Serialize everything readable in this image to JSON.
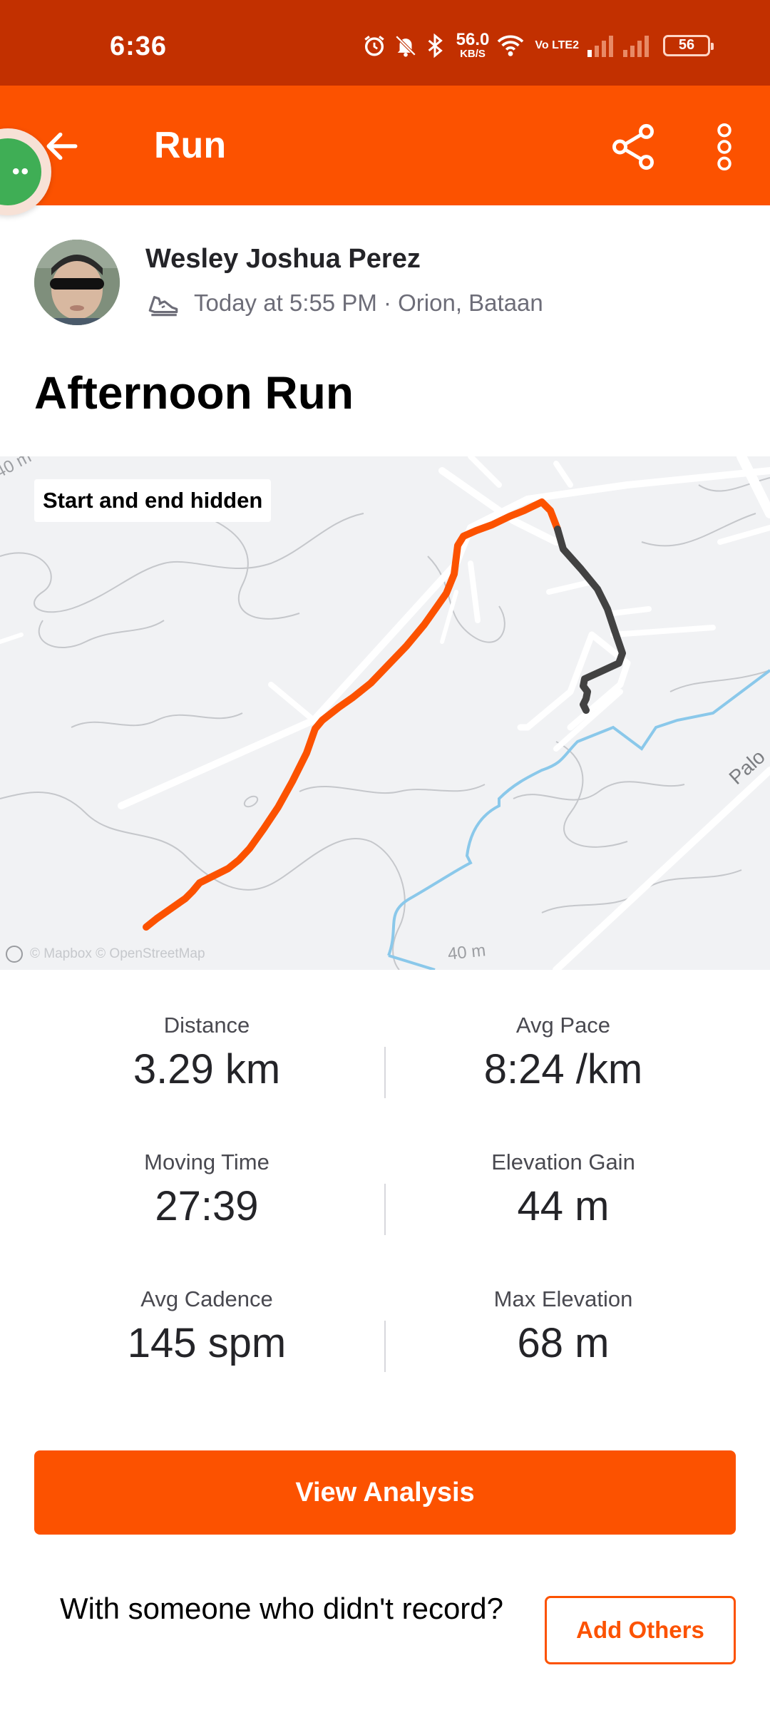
{
  "status_bar": {
    "time": "6:36",
    "net_speed_value": "56.0",
    "net_speed_unit": "KB/S",
    "volte": "Vo LTE2",
    "battery": "56"
  },
  "app_bar": {
    "title": "Run",
    "back_icon": "arrow-left-icon",
    "share_icon": "share-icon",
    "more_icon": "more-vertical-icon"
  },
  "chat_bubble": {
    "dots": "••"
  },
  "athlete": {
    "name": "Wesley Joshua Perez",
    "meta": "Today at 5:55 PM · Orion, Bataan",
    "sport_icon": "running-shoe-icon"
  },
  "activity": {
    "title": "Afternoon Run"
  },
  "map": {
    "badge": "Start and end hidden",
    "attribution": "© Mapbox © OpenStreetMap",
    "contour_top": "40 m",
    "contour_bottom": "40 m",
    "road_label": "Palo",
    "route_color": "#fc5200",
    "route_hidden_color": "#424242",
    "water_color": "#8ac8ea"
  },
  "stats": [
    {
      "left": {
        "label": "Distance",
        "value": "3.29 km"
      },
      "right": {
        "label": "Avg Pace",
        "value": "8:24 /km"
      }
    },
    {
      "left": {
        "label": "Moving Time",
        "value": "27:39"
      },
      "right": {
        "label": "Elevation Gain",
        "value": "44 m"
      }
    },
    {
      "left": {
        "label": "Avg Cadence",
        "value": "145 spm"
      },
      "right": {
        "label": "Max Elevation",
        "value": "68 m"
      }
    }
  ],
  "actions": {
    "view_analysis": "View Analysis",
    "someone_prompt": "With someone who didn't record?",
    "add_others": "Add Others"
  },
  "colors": {
    "brand": "#fc5200",
    "status_bar": "#c23000"
  }
}
